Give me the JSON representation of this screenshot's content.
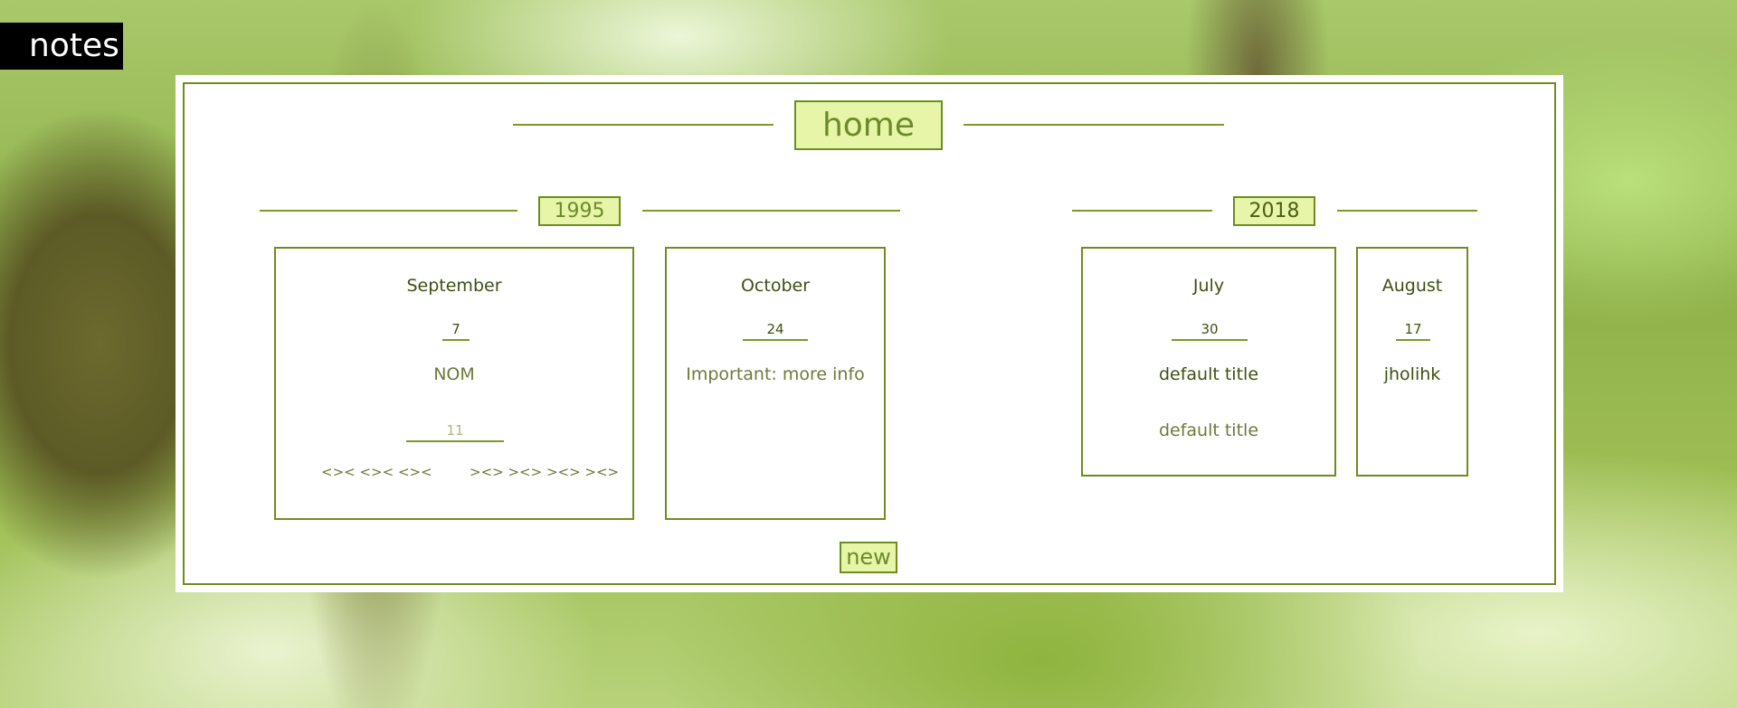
{
  "app": {
    "brand": "notes"
  },
  "header": {
    "title": "home"
  },
  "years": [
    {
      "label": "1995",
      "months": [
        {
          "name": "September",
          "days": [
            {
              "day": "7",
              "notes": [
                "NOM"
              ]
            },
            {
              "day": "11",
              "links": [
                "<>< <>< <><",
                "><> ><> ><> ><>"
              ]
            }
          ]
        },
        {
          "name": "October",
          "days": [
            {
              "day": "24",
              "notes": [
                "Important: more info"
              ]
            }
          ]
        }
      ]
    },
    {
      "label": "2018",
      "months": [
        {
          "name": "July",
          "days": [
            {
              "day": "30",
              "notes": [
                "default title",
                "default title"
              ]
            }
          ]
        },
        {
          "name": "August",
          "days": [
            {
              "day": "17",
              "notes": [
                "jholihk"
              ]
            }
          ]
        }
      ]
    }
  ],
  "actions": {
    "new_label": "new"
  },
  "colors": {
    "accent_fill": "#e6f5a8",
    "accent_border": "#6f8c1e",
    "text_dark": "#3f4f12",
    "text_muted": "#6d7a3a",
    "brand_bg": "#000000"
  }
}
